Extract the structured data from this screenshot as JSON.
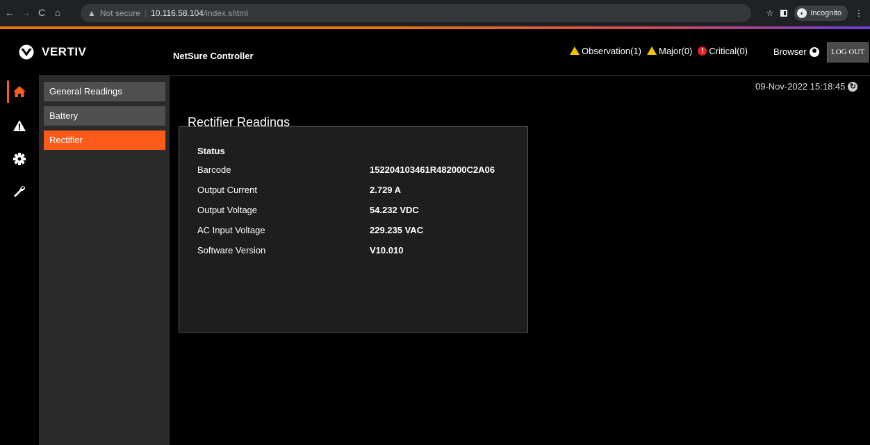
{
  "browser": {
    "security_label": "Not secure",
    "url_host": "10.116.58.104",
    "url_path": "/index.shtml",
    "incognito_label": "Incognito"
  },
  "header": {
    "brand": "VERTIV",
    "product": "NetSure Controller",
    "alarms": {
      "observation": "Observation(1)",
      "major": "Major(0)",
      "critical": "Critical(0)"
    },
    "user": "Browser",
    "logout": "LOG OUT"
  },
  "rail": {
    "items": [
      {
        "icon": "home-icon",
        "active": true
      },
      {
        "icon": "alarm-icon",
        "active": false
      },
      {
        "icon": "settings-gear-icon",
        "active": false
      },
      {
        "icon": "wrench-icon",
        "active": false
      }
    ]
  },
  "submenu": {
    "items": [
      {
        "label": "General Readings",
        "active": false
      },
      {
        "label": "Battery",
        "active": false
      },
      {
        "label": "Rectifier",
        "active": true
      }
    ]
  },
  "main": {
    "datetime": "09-Nov-2022 15:18:45",
    "title": "Rectifier Readings",
    "card": {
      "heading": "Status",
      "rows": [
        {
          "label": "Barcode",
          "value": "152204103461R482000C2A06"
        },
        {
          "label": "Output Current",
          "value": "2.729 A"
        },
        {
          "label": "Output Voltage",
          "value": "54.232 VDC"
        },
        {
          "label": "AC Input Voltage",
          "value": "229.235 VAC"
        },
        {
          "label": "Software Version",
          "value": "V10.010"
        }
      ]
    }
  },
  "colors": {
    "accent": "#fe5b1a",
    "submenu_bg": "#2b2b2b",
    "warning": "#f2c300",
    "critical": "#e02424"
  }
}
